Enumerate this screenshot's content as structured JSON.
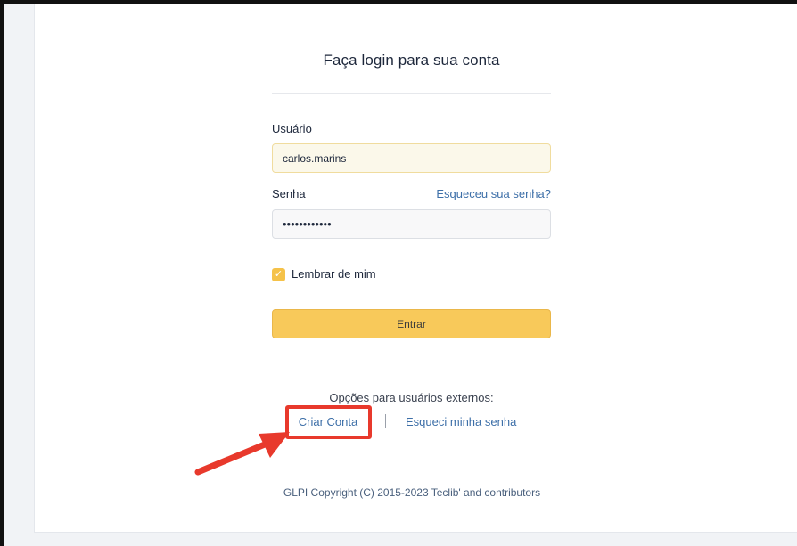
{
  "login": {
    "title": "Faça login para sua conta",
    "username_label": "Usuário",
    "username_value": "carlos.marins",
    "password_label": "Senha",
    "password_masked": "••••••••••••",
    "forgot_password_link": "Esqueceu sua senha?",
    "remember_label": "Lembrar de mim",
    "remember_checked": true,
    "submit_label": "Entrar"
  },
  "external": {
    "title": "Opções para usuários externos:",
    "create_account_link": "Criar Conta",
    "separator": "|",
    "reset_link": "Esqueci minha senha"
  },
  "footer": {
    "copyright": "GLPI Copyright (C) 2015-2023 Teclib' and contributors"
  },
  "colors": {
    "accent": "#f8c95a",
    "link": "#3d6fa8",
    "annotation": "#e8392c"
  },
  "icons": {
    "checkbox_check": "check-icon",
    "annotation_arrow": "arrow-icon"
  }
}
